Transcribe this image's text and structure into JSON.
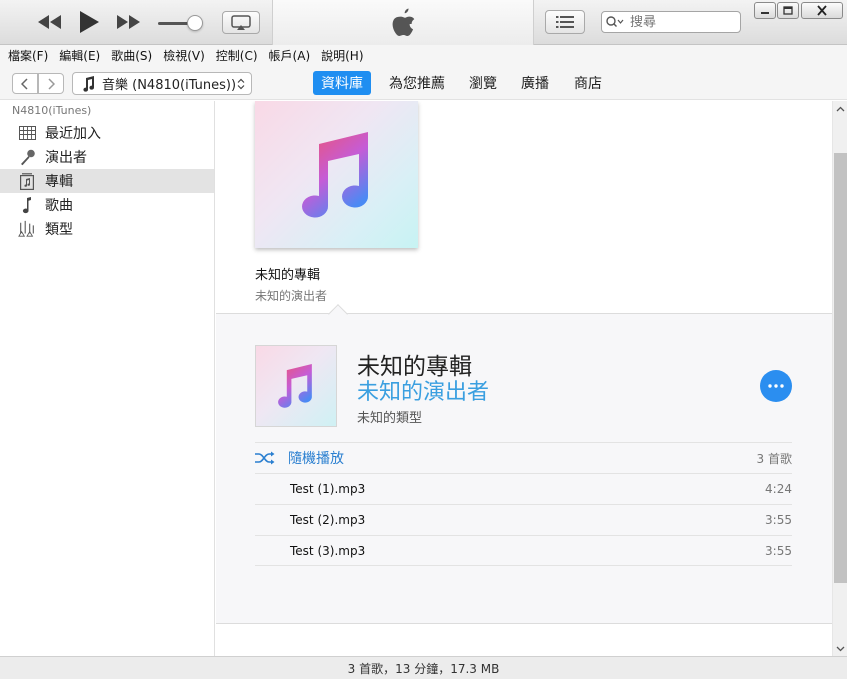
{
  "search": {
    "placeholder": "搜尋"
  },
  "menu": [
    "檔案(F)",
    "編輯(E)",
    "歌曲(S)",
    "檢視(V)",
    "控制(C)",
    "帳戶(A)",
    "說明(H)"
  ],
  "nav": {
    "source": "音樂 (N4810(iTunes))",
    "tabs": [
      "資料庫",
      "為您推薦",
      "瀏覽",
      "廣播",
      "商店"
    ],
    "active_tab": "資料庫"
  },
  "sidebar": {
    "header": "N4810(iTunes)",
    "items": [
      {
        "label": "最近加入",
        "icon": "grid-icon"
      },
      {
        "label": "演出者",
        "icon": "microphone-icon"
      },
      {
        "label": "專輯",
        "icon": "album-icon"
      },
      {
        "label": "歌曲",
        "icon": "music-note-icon"
      },
      {
        "label": "類型",
        "icon": "genres-icon"
      }
    ],
    "selected": "專輯"
  },
  "album": {
    "title": "未知的專輯",
    "artist": "未知的演出者",
    "genre": "未知的類型",
    "shuffle_label": "隨機播放",
    "song_count": "3 首歌",
    "tracks": [
      {
        "name": "Test (1).mp3",
        "duration": "4:24"
      },
      {
        "name": "Test (2).mp3",
        "duration": "3:55"
      },
      {
        "name": "Test (3).mp3",
        "duration": "3:55"
      }
    ]
  },
  "status": {
    "text": "3 首歌，13 分鐘，17.3 MB"
  },
  "colors": {
    "accent": "#1f8ef1",
    "artist_blue": "#3a9fe0",
    "selection": "#e3e3e3"
  }
}
